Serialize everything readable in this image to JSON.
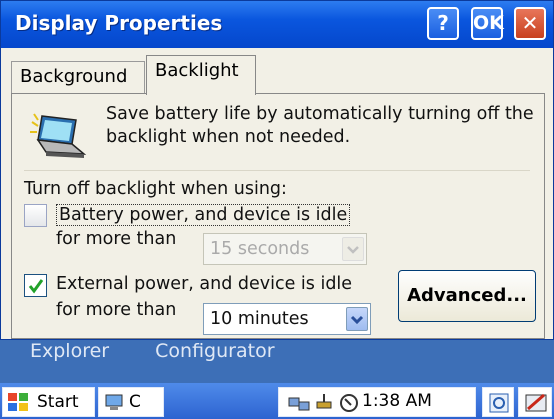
{
  "window": {
    "title": "Display Properties",
    "help_label": "?",
    "ok_label": "OK",
    "close_label": "✕"
  },
  "tabs": [
    {
      "label": "Background"
    },
    {
      "label": "Backlight"
    }
  ],
  "backlight": {
    "description": "Save battery life by automatically turning off the backlight when not needed.",
    "heading": "Turn off backlight when using:",
    "battery": {
      "checked": false,
      "label": "Battery power, and device is idle",
      "for_label": "for more than",
      "value": "15 seconds",
      "enabled": false
    },
    "external": {
      "checked": true,
      "label": "External power, and device is idle",
      "for_label": "for more than",
      "value": "10 minutes",
      "enabled": true
    },
    "advanced_label": "Advanced..."
  },
  "desktop": {
    "labels": [
      "Explorer",
      "Configurator"
    ]
  },
  "taskbar": {
    "start_label": "Start",
    "task_label": "C",
    "time": "1:38 AM"
  },
  "colors": {
    "titlebar": "#0a56de",
    "dialog_bg": "#f2f0e6",
    "taskbar": "#2d63d0",
    "check_green": "#22a22a"
  }
}
